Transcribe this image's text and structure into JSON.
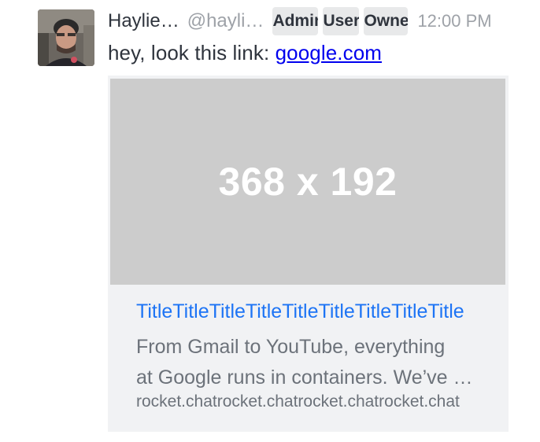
{
  "message": {
    "author_name": "Haylie…",
    "username": "@hayli…",
    "roles": [
      "Admin",
      "User",
      "Owner"
    ],
    "time": "12:00 PM",
    "text_prefix": "hey, look this link: ",
    "link_text": "google.com"
  },
  "preview": {
    "image_label": "368 x 192",
    "title": "TitleTitleTitleTitleTitleTitleTitleTitleTitle",
    "description_line1": "From Gmail to YouTube, everything",
    "description_line2": "at Google runs in containers. We’ve been running them for years",
    "url": "rocket.chatrocket.chatrocket.chatrocket.chat"
  },
  "colors": {
    "link": "#0000ee",
    "preview_title": "#1d74f5",
    "muted": "#9ea2a8",
    "role_badge_bg": "#e8e9ea",
    "preview_bg": "#f1f2f4",
    "placeholder_bg": "#cccccc"
  },
  "icons": {
    "avatar": "user-avatar-photo"
  }
}
